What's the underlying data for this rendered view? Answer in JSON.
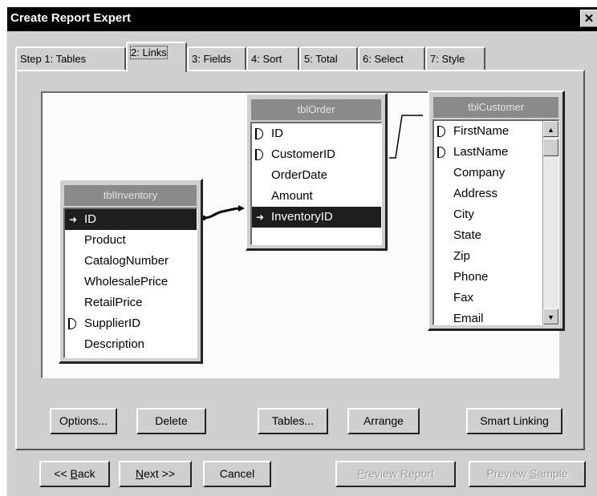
{
  "window": {
    "title": "Create Report Expert",
    "close_label": "✕"
  },
  "tabs": [
    {
      "label": "Step 1: Tables"
    },
    {
      "label": "2: Links"
    },
    {
      "label": "3: Fields"
    },
    {
      "label": "4: Sort"
    },
    {
      "label": "5: Total"
    },
    {
      "label": "6: Select"
    },
    {
      "label": "7: Style"
    }
  ],
  "active_tab": "2: Links",
  "tables": {
    "inventory": {
      "name": "tblInventory",
      "fields": [
        "ID",
        "Product",
        "CatalogNumber",
        "WholesalePrice",
        "RetailPrice",
        "SupplierID",
        "Description"
      ],
      "selected": "ID"
    },
    "order": {
      "name": "tblOrder",
      "fields": [
        "ID",
        "CustomerID",
        "OrderDate",
        "Amount",
        "InventoryID"
      ],
      "selected": "InventoryID"
    },
    "customer": {
      "name": "tblCustomer",
      "fields": [
        "FirstName",
        "LastName",
        "Company",
        "Address",
        "City",
        "State",
        "Zip",
        "Phone",
        "Fax",
        "Email"
      ]
    }
  },
  "links": [
    {
      "from": "tblInventory.ID",
      "to": "tblOrder.InventoryID"
    },
    {
      "from": "tblOrder.CustomerID",
      "to": "tblCustomer.FirstName"
    }
  ],
  "buttons": {
    "options": "Options...",
    "delete": "Delete",
    "tables": "Tables...",
    "arrange": "Arrange",
    "smart_linking": "Smart Linking"
  },
  "nav": {
    "back_prefix": "<< ",
    "back_underline": "B",
    "back_rest": "ack",
    "next_underline": "N",
    "next_rest": "ext >>",
    "cancel": "Cancel",
    "preview_report_underline": "P",
    "preview_report_rest": "review Report",
    "preview_sample_prefix": "Preview ",
    "preview_sample_underline": "S",
    "preview_sample_rest": "ample"
  },
  "colors": {
    "dialog_bg": "#cfcfcf",
    "title_bar": "#000000",
    "selection": "#1e1e1e",
    "table_header": "#8a8a8a"
  }
}
